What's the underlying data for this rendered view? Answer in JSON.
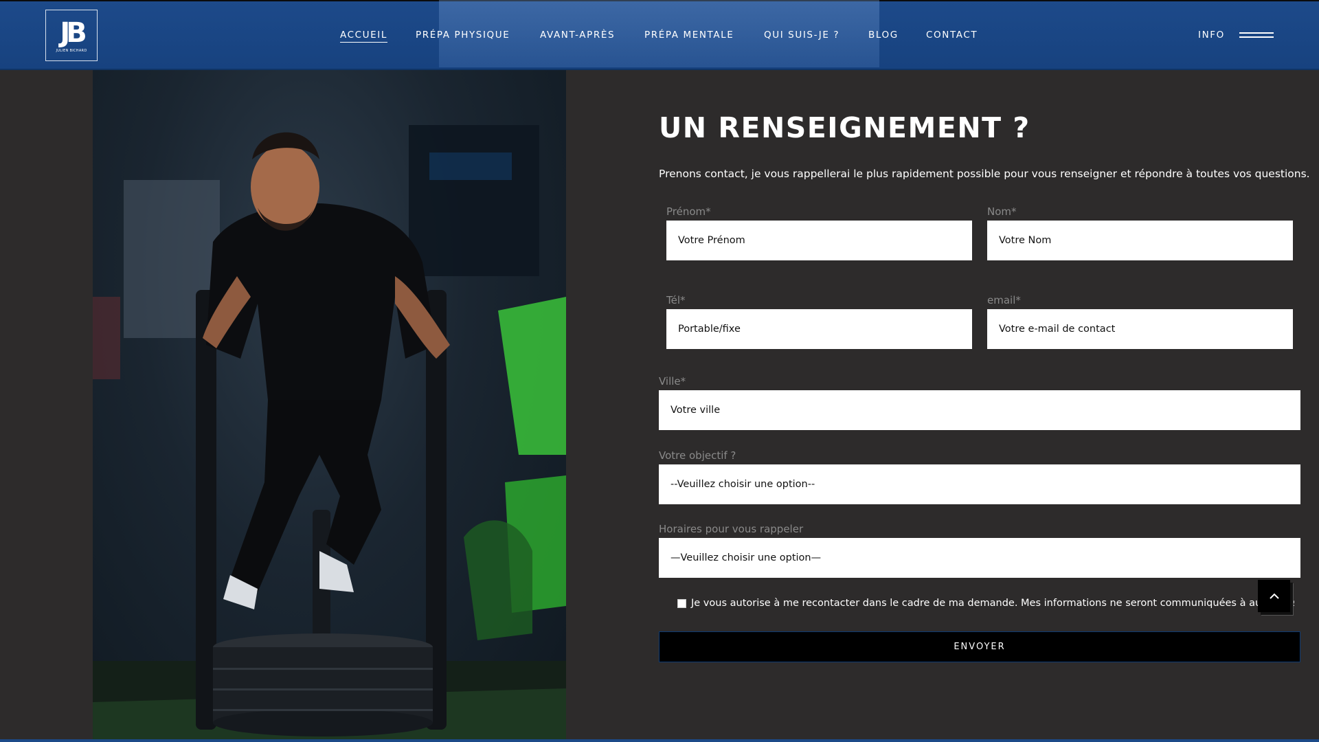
{
  "brand": {
    "logo_text": "JB",
    "logo_subtitle": "JULIEN BICHARD"
  },
  "nav": {
    "items": [
      {
        "label": "ACCUEIL",
        "active": true
      },
      {
        "label": "PRÉPA PHYSIQUE",
        "active": false
      },
      {
        "label": "AVANT-APRÈS",
        "active": false
      },
      {
        "label": "PRÉPA MENTALE",
        "active": false
      },
      {
        "label": "QUI SUIS-JE ?",
        "active": false
      },
      {
        "label": "BLOG",
        "active": false
      },
      {
        "label": "CONTACT",
        "active": false
      }
    ],
    "info_label": "INFO",
    "menu_icon": "hamburger-icon"
  },
  "contact": {
    "title": "UN RENSEIGNEMENT ?",
    "intro": "Prenons contact, je vous rappellerai le plus rapidement possible pour vous renseigner et répondre à toutes vos questions.",
    "fields": {
      "prenom": {
        "label": "Prénom*",
        "placeholder": "Votre Prénom"
      },
      "nom": {
        "label": "Nom*",
        "placeholder": "Votre Nom"
      },
      "tel": {
        "label": "Tél*",
        "placeholder": "Portable/fixe"
      },
      "email": {
        "label": "email*",
        "placeholder": "Votre e-mail de contact"
      },
      "ville": {
        "label": "Ville*",
        "placeholder": "Votre ville"
      },
      "objectif": {
        "label": "Votre objectif ?",
        "value": "--Veuillez choisir une option--"
      },
      "horaires": {
        "label": "Horaires pour vous rappeler",
        "value": "—Veuillez choisir une option—"
      }
    },
    "consent_text": "Je vous autorise à me recontacter dans le cadre de ma demande. Mes informations ne seront communiquées à aucun tiers.",
    "submit_label": "ENVOYER"
  },
  "colors": {
    "header_blue": "#1d4a8a",
    "page_background": "#2d2b2b",
    "submit_background": "#000000",
    "label_gray": "#8a8a8a"
  }
}
